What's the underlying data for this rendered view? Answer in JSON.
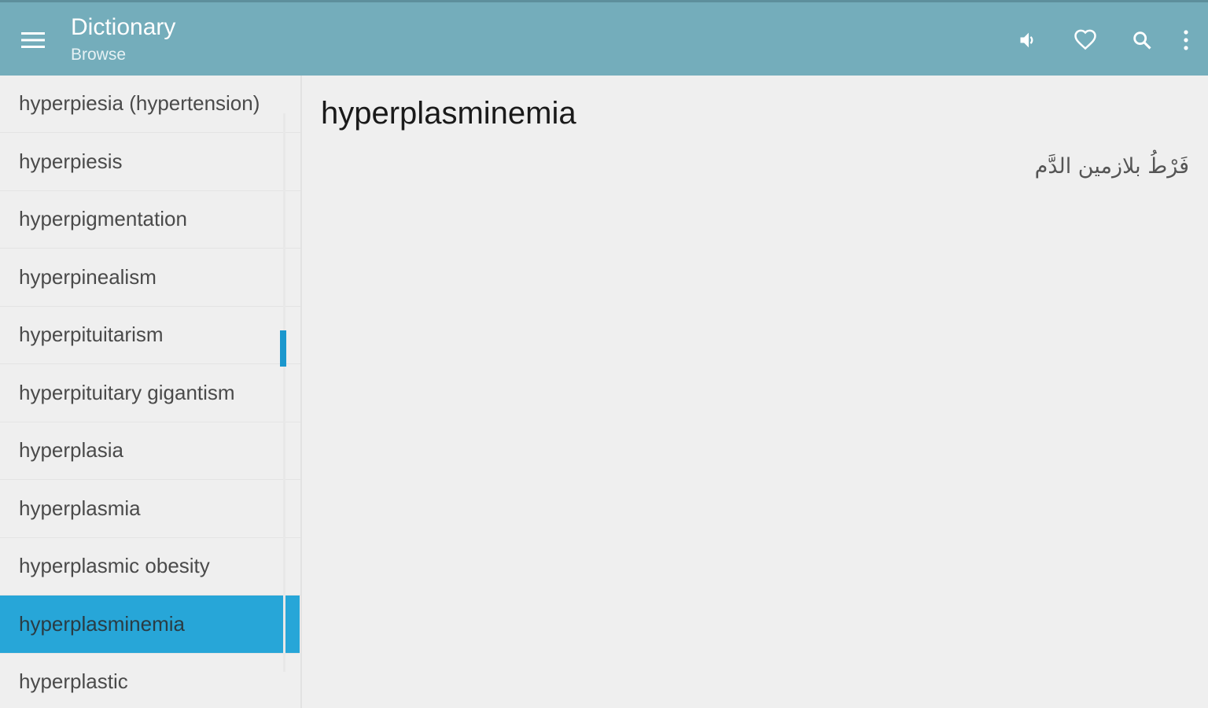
{
  "appbar": {
    "title": "Dictionary",
    "subtitle": "Browse",
    "icons": [
      "menu-icon",
      "speaker-icon",
      "heart-icon",
      "search-icon",
      "more-vert-icon"
    ],
    "color": "#74adbb"
  },
  "sidebar": {
    "items": [
      {
        "label": "hyperpiesia (hypertension)"
      },
      {
        "label": "hyperpiesis"
      },
      {
        "label": "hyperpigmentation"
      },
      {
        "label": "hyperpinealism"
      },
      {
        "label": "hyperpituitarism"
      },
      {
        "label": "hyperpituitary gigantism"
      },
      {
        "label": "hyperplasia"
      },
      {
        "label": "hyperplasmia"
      },
      {
        "label": "hyperplasmic obesity"
      },
      {
        "label": "hyperplasminemia"
      },
      {
        "label": "hyperplastic"
      }
    ],
    "selected_index": 9,
    "selected_color": "#27a6d8"
  },
  "entry": {
    "headword": "hyperplasminemia",
    "translation": "فَرْطُ بلازمين الدَّم"
  }
}
